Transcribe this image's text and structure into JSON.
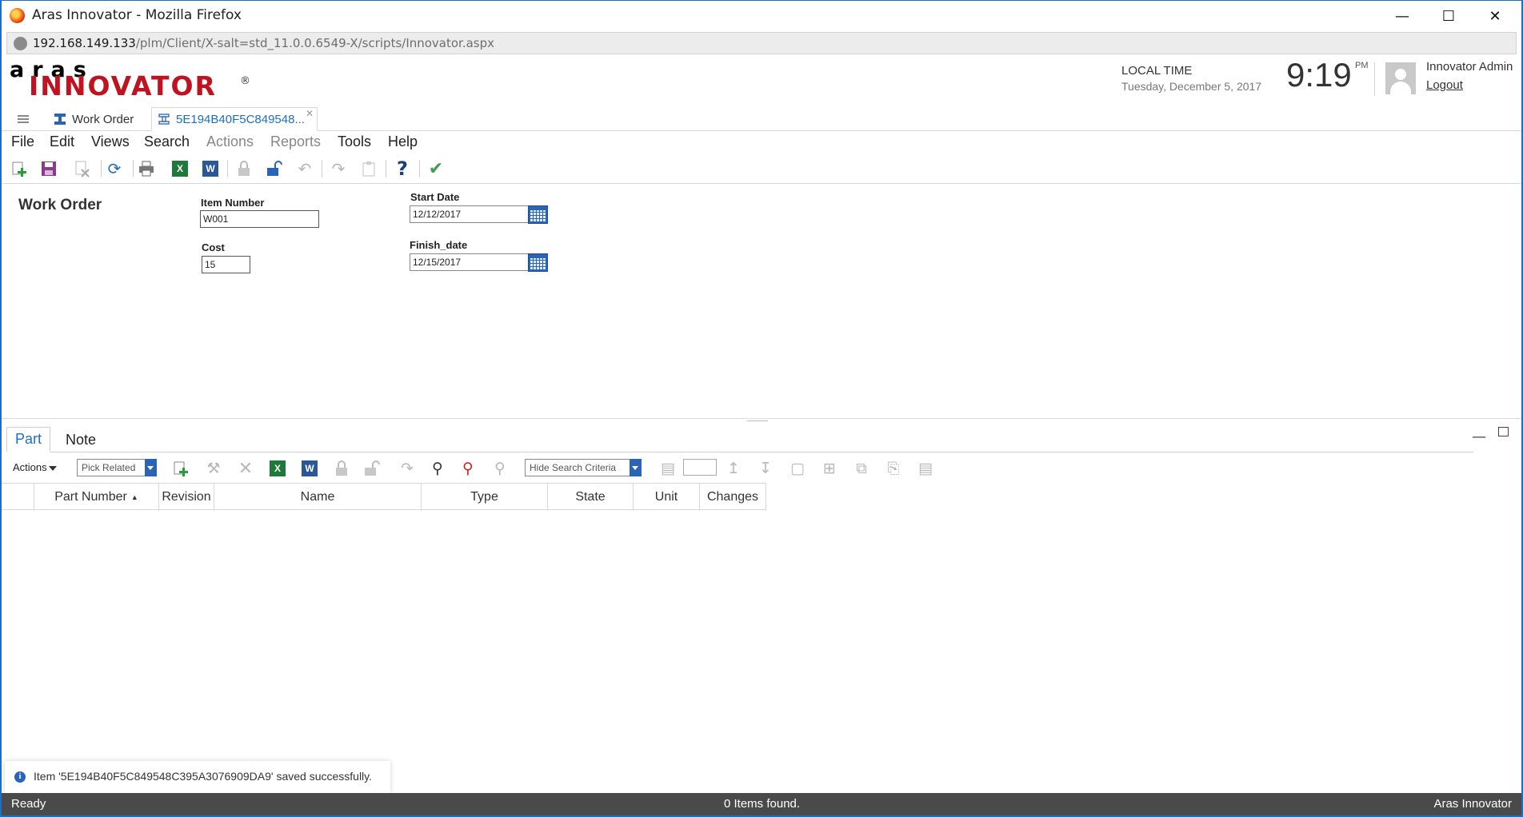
{
  "window": {
    "title": "Aras Innovator - Mozilla Firefox"
  },
  "address": {
    "host": "192.168.149.133",
    "path": "/plm/Client/X-salt=std_11.0.0.6549-X/scripts/Innovator.aspx"
  },
  "logo": {
    "top": "aras",
    "main": "INNOVATOR",
    "reg": "®"
  },
  "clock": {
    "label": "LOCAL TIME",
    "date": "Tuesday, December 5, 2017",
    "time": "9:19",
    "ampm": "PM"
  },
  "user": {
    "name": "Innovator Admin",
    "logout": "Logout"
  },
  "tabs": [
    {
      "label": "Work Order",
      "icon": "itemtype-icon"
    },
    {
      "label": "5E194B40F5C849548...",
      "icon": "item-icon"
    }
  ],
  "menu": [
    "File",
    "Edit",
    "Views",
    "Search",
    "Actions",
    "Reports",
    "Tools",
    "Help"
  ],
  "toolbar": [
    "new-icon",
    "save-icon",
    "discard-icon",
    "refresh-icon",
    "print-icon",
    "excel-icon",
    "word-icon",
    "lock-icon",
    "unlock-icon",
    "undo-icon",
    "promote-icon",
    "clipboard-icon",
    "help-icon",
    "done-icon"
  ],
  "form": {
    "title": "Work Order",
    "item_number": {
      "label": "Item Number",
      "value": "W001"
    },
    "cost": {
      "label": "Cost",
      "value": "15"
    },
    "start_date": {
      "label": "Start Date",
      "value": "12/12/2017"
    },
    "finish_date": {
      "label": "Finish_date",
      "value": "12/15/2017"
    }
  },
  "relationships": {
    "tabs": [
      "Part",
      "Note"
    ],
    "actions_label": "Actions",
    "pick_related": "Pick Related",
    "search_criteria": "Hide Search Criteria",
    "columns": [
      {
        "label": "Part Number",
        "sorted": "asc"
      },
      {
        "label": "Revision"
      },
      {
        "label": "Name"
      },
      {
        "label": "Type"
      },
      {
        "label": "State"
      },
      {
        "label": "Unit"
      },
      {
        "label": "Changes"
      }
    ]
  },
  "notification": {
    "message": "Item '5E194B40F5C849548C395A3076909DA9' saved successfully."
  },
  "status": {
    "left": "Ready",
    "center": "0 Items found.",
    "right": "Aras Innovator"
  },
  "colors": {
    "accent": "#1e6fbf",
    "brand_red": "#c1121f",
    "statusbar": "#4a4a4a"
  }
}
